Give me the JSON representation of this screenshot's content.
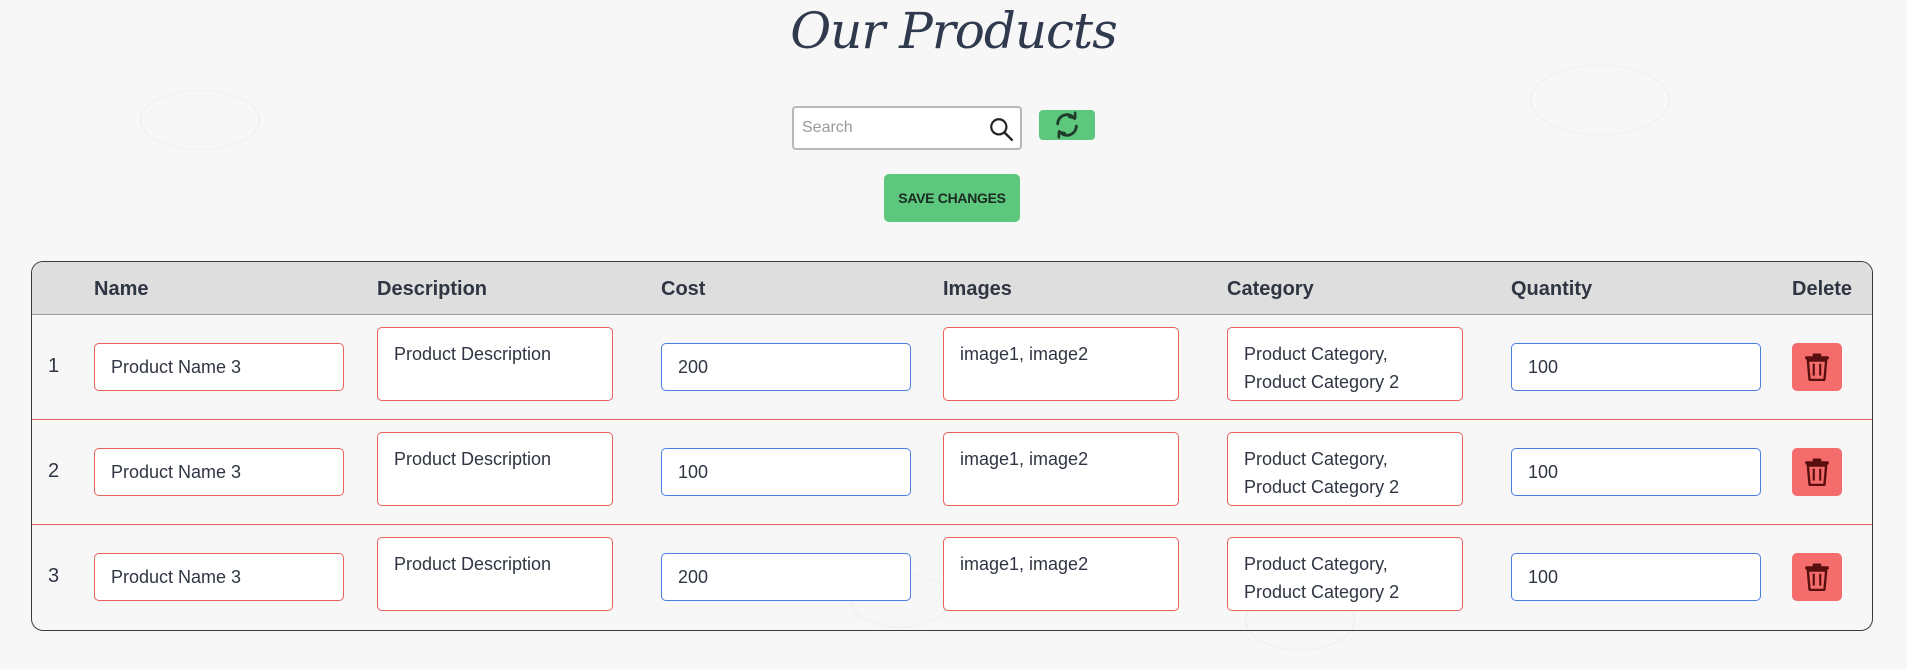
{
  "page": {
    "title": "Our Products"
  },
  "search": {
    "placeholder": "Search",
    "value": ""
  },
  "toolbar": {
    "save_label": "SAVE CHANGES"
  },
  "table": {
    "headers": [
      "Name",
      "Description",
      "Cost",
      "Images",
      "Category",
      "Quantity",
      "Delete"
    ],
    "rows": [
      {
        "index": "1",
        "name": "Product Name 3",
        "description": "Product Description",
        "cost": "200",
        "images": "image1, image2",
        "category_line1": "Product Category,",
        "category_line2": "Product Category 2",
        "quantity": "100"
      },
      {
        "index": "2",
        "name": "Product Name 3",
        "description": "Product Description",
        "cost": "100",
        "images": "image1, image2",
        "category_line1": "Product Category,",
        "category_line2": "Product Category 2",
        "quantity": "100"
      },
      {
        "index": "3",
        "name": "Product Name 3",
        "description": "Product Description",
        "cost": "200",
        "images": "image1, image2",
        "category_line1": "Product Category,",
        "category_line2": "Product Category 2",
        "quantity": "100"
      }
    ]
  },
  "colors": {
    "accent_green": "#5cc77d",
    "danger_red": "#f46c6c",
    "invalid_border": "#e8615a",
    "valid_border": "#4a7fe0",
    "header_bg": "#dedede"
  },
  "icons": {
    "search": "search-icon",
    "refresh": "refresh-icon",
    "delete": "trash-icon"
  }
}
